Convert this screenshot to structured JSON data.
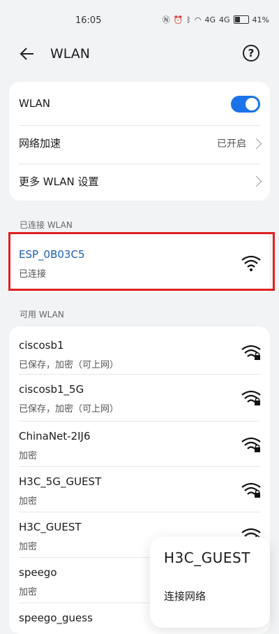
{
  "status": {
    "time": "16:05",
    "network1": "4G",
    "network2": "4G",
    "battery": "41%"
  },
  "header": {
    "title": "WLAN",
    "help_glyph": "?"
  },
  "settings": {
    "wlan_label": "WLAN",
    "wlan_enabled": true,
    "accel_label": "网络加速",
    "accel_value": "已开启",
    "more_label": "更多 WLAN 设置"
  },
  "connected": {
    "section": "已连接 WLAN",
    "name": "ESP_0B03C5",
    "status": "已连接"
  },
  "available": {
    "section": "可用 WLAN",
    "networks": [
      {
        "name": "ciscosb1",
        "status": "已保存，加密（可上网）"
      },
      {
        "name": "ciscosb1_5G",
        "status": "已保存，加密（可上网）"
      },
      {
        "name": "ChinaNet-2IJ6",
        "status": "加密"
      },
      {
        "name": "H3C_5G_GUEST",
        "status": "加密"
      },
      {
        "name": "H3C_GUEST",
        "status": "加密"
      },
      {
        "name": "speego",
        "status": "加密"
      },
      {
        "name": "speego_guess",
        "status": ""
      }
    ]
  },
  "popup": {
    "title": "H3C_GUEST",
    "action": "连接网络"
  },
  "colors": {
    "accent": "#1a73e8",
    "connected_text": "#1a5fb4",
    "highlight": "#e02020"
  }
}
